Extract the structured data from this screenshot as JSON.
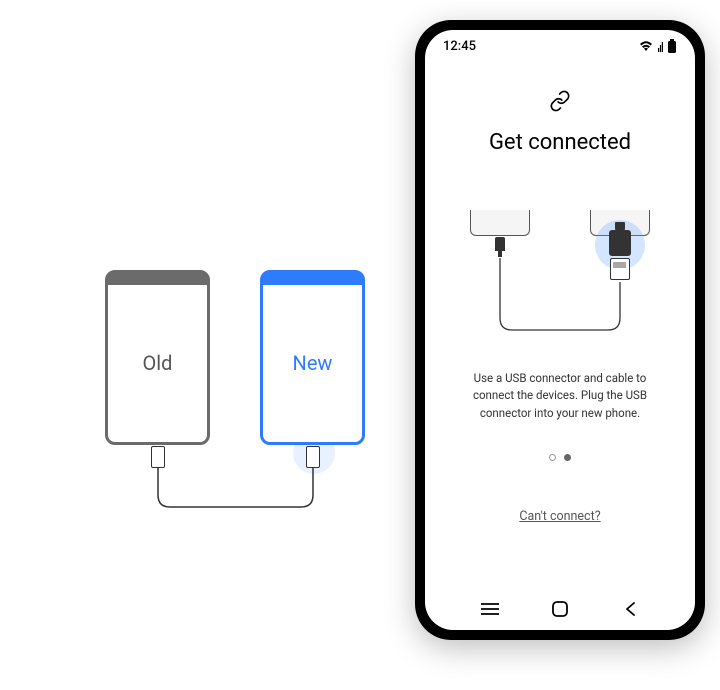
{
  "left_diagram": {
    "old_label": "Old",
    "new_label": "New"
  },
  "phone": {
    "status": {
      "time": "12:45"
    },
    "screen": {
      "title": "Get connected",
      "instruction": "Use a USB connector and cable to connect the devices. Plug the USB connector into your new phone.",
      "link_label": "Can't connect?",
      "page_indicator": {
        "total": 2,
        "current": 2
      }
    }
  }
}
